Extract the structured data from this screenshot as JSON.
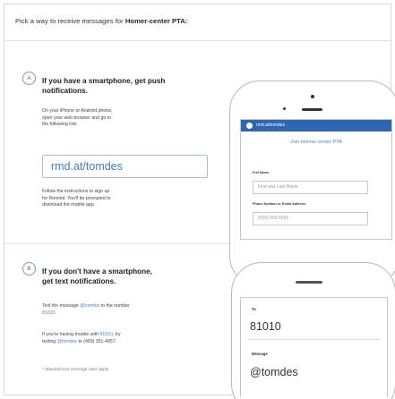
{
  "header": {
    "prefix": "Pick a way to receive messages for ",
    "group": "Homer-center PTA:"
  },
  "smartphone_section": {
    "badge": "A",
    "title_line1": "If you have a smartphone, get push",
    "title_line2": "notifications.",
    "instructions_line1": "On your iPhone or Android phone,",
    "instructions_line2": "open your web browser and go to",
    "instructions_line3": "the following link:",
    "link": "rmd.at/tomdes",
    "follow_line1": "Follow the instructions to sign up",
    "follow_line2": "for Remind. You'll be prompted to",
    "follow_line3": "download the mobile app."
  },
  "phone_browser": {
    "url": "rmd.at/tomdes",
    "join_title": "Join Homer-center PTA",
    "full_name_label": "Full Name",
    "full_name_placeholder": "First and Last Name",
    "contact_label": "Phone Number or Email Address",
    "contact_placeholder": "(555) 555-5555"
  },
  "sms_section": {
    "badge": "B",
    "title_line1": "If you don't have a smartphone,",
    "title_line2": "get text notifications.",
    "text_pre": "Text the message ",
    "text_code": "@tomdes",
    "text_post": " to the number",
    "number": "81010.",
    "trouble_pre": "If you're having trouble with ",
    "trouble_number": "81010",
    "trouble_mid": ", try",
    "trouble_line2_pre": "texting ",
    "trouble_code": "@tomdes",
    "trouble_line2_post": " to (469) 351-4957.",
    "footnote": "* Standard text message rates apply."
  },
  "phone_sms": {
    "to_label": "To",
    "to_value": "81010",
    "message_label": "Message",
    "message_value": "@tomdes"
  },
  "colors": {
    "accent": "#4a86d8",
    "bar": "#2f66b3"
  }
}
